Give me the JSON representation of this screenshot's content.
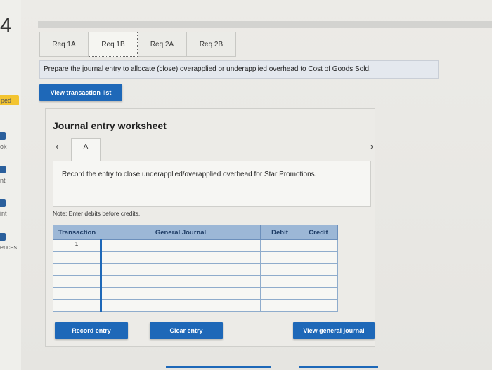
{
  "sidebar": {
    "number": "4",
    "badge": "ped",
    "items": [
      {
        "label": "ok"
      },
      {
        "label": "nt"
      },
      {
        "label": "int"
      },
      {
        "label": "ences"
      }
    ]
  },
  "tabs": [
    {
      "label": "Req 1A"
    },
    {
      "label": "Req 1B"
    },
    {
      "label": "Req 2A"
    },
    {
      "label": "Req 2B"
    }
  ],
  "prompt": "Prepare the journal entry to allocate (close) overapplied or underapplied overhead to Cost of Goods Sold.",
  "view_transaction_label": "View transaction list",
  "worksheet": {
    "title": "Journal entry worksheet",
    "prev_icon": "‹",
    "next_icon": "›",
    "entry_tab": "A",
    "instruction": "Record the entry to close underapplied/overapplied overhead for Star Promotions.",
    "note": "Note: Enter debits before credits.",
    "columns": {
      "transaction": "Transaction",
      "general_journal": "General Journal",
      "debit": "Debit",
      "credit": "Credit"
    },
    "rows": [
      {
        "transaction": "1"
      },
      {
        "transaction": ""
      },
      {
        "transaction": ""
      },
      {
        "transaction": ""
      },
      {
        "transaction": ""
      },
      {
        "transaction": ""
      }
    ]
  },
  "buttons": {
    "record": "Record entry",
    "clear": "Clear entry",
    "view_general": "View general journal"
  },
  "colors": {
    "accent": "#1e68b8",
    "header_bg": "#9cb7d6"
  }
}
